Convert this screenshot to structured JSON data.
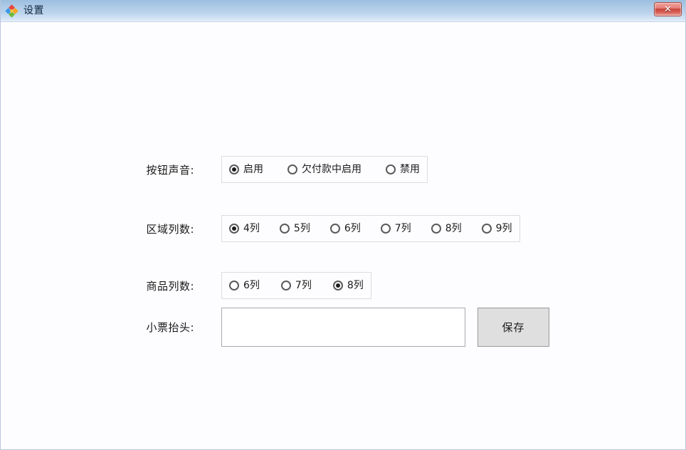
{
  "window": {
    "title": "设置",
    "icon": "app-diamond-icon",
    "close_label": "✕",
    "titlebar_gradient_top": "#9cbee0",
    "titlebar_gradient_bottom": "#e7f0fa",
    "client_background": "#fdfdff",
    "border_color": "#b9c7dd"
  },
  "form": {
    "rows": [
      {
        "label": "按钮声音:",
        "name": "button-sound",
        "options": [
          {
            "label": "启用",
            "checked": true
          },
          {
            "label": "欠付款中启用",
            "checked": false
          },
          {
            "label": "禁用",
            "checked": false
          }
        ]
      },
      {
        "label": "区域列数:",
        "name": "area-columns",
        "options": [
          {
            "label": "4列",
            "checked": true
          },
          {
            "label": "5列",
            "checked": false
          },
          {
            "label": "6列",
            "checked": false
          },
          {
            "label": "7列",
            "checked": false
          },
          {
            "label": "8列",
            "checked": false
          },
          {
            "label": "9列",
            "checked": false
          }
        ]
      },
      {
        "label": "商品列数:",
        "name": "product-columns",
        "options": [
          {
            "label": "6列",
            "checked": false
          },
          {
            "label": "7列",
            "checked": false
          },
          {
            "label": "8列",
            "checked": true
          }
        ]
      }
    ],
    "receipt": {
      "label": "小票抬头:",
      "value": "",
      "placeholder": "",
      "save_label": "保存"
    }
  }
}
